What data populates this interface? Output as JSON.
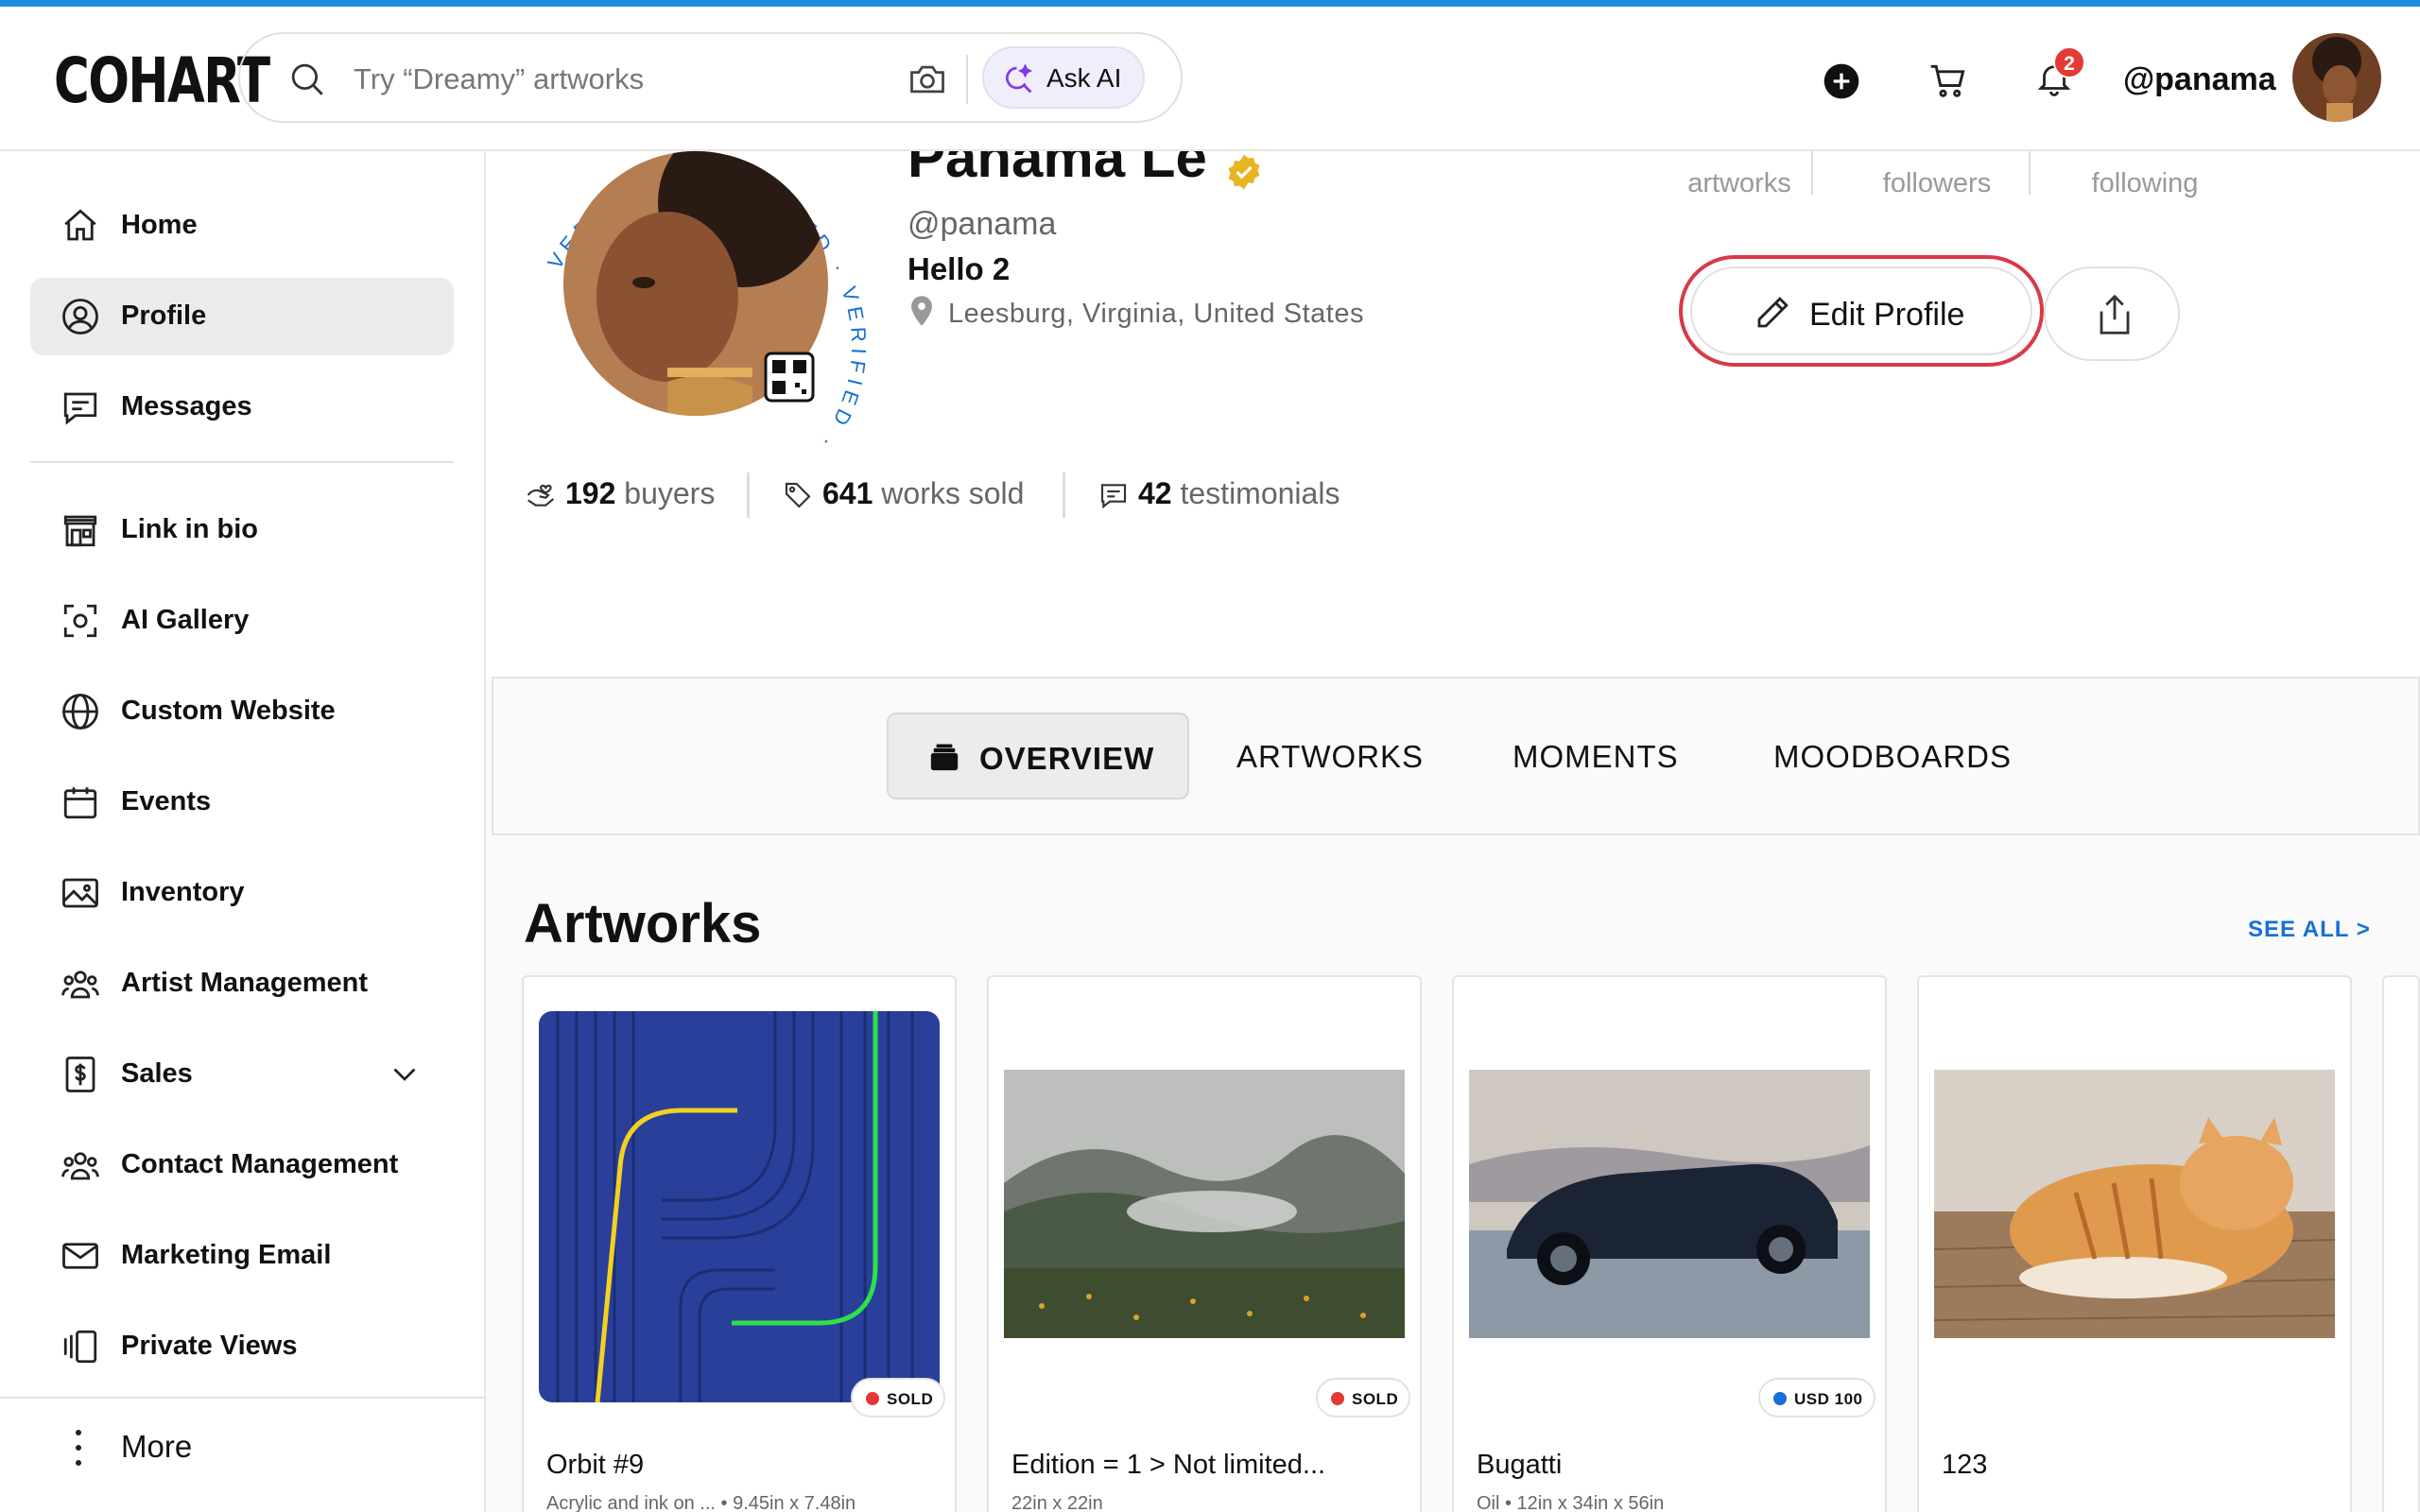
{
  "header": {
    "logo": "COHART",
    "search_placeholder": "Try “Dreamy” artworks",
    "ask_ai_label": "Ask AI",
    "notification_count": "2",
    "username": "@panama"
  },
  "sidebar": {
    "items": [
      {
        "label": "Home",
        "icon": "home-icon"
      },
      {
        "label": "Profile",
        "icon": "user-circle-icon",
        "active": true
      },
      {
        "label": "Messages",
        "icon": "message-icon"
      },
      {
        "label": "Link in bio",
        "icon": "storefront-icon"
      },
      {
        "label": "AI Gallery",
        "icon": "scan-face-icon"
      },
      {
        "label": "Custom Website",
        "icon": "globe-icon"
      },
      {
        "label": "Events",
        "icon": "calendar-icon"
      },
      {
        "label": "Inventory",
        "icon": "image-icon"
      },
      {
        "label": "Artist Management",
        "icon": "users-icon"
      },
      {
        "label": "Sales",
        "icon": "dollar-file-icon"
      },
      {
        "label": "Contact Management",
        "icon": "users-icon"
      },
      {
        "label": "Marketing Email",
        "icon": "mail-icon"
      },
      {
        "label": "Private Views",
        "icon": "private-views-icon"
      }
    ],
    "more_label": "More"
  },
  "profile": {
    "name": "Panama Le",
    "handle": "@panama",
    "bio": "Hello 2",
    "location": "Leesburg, Virginia, United States",
    "ring_text": "VERIFIED · VERIFIED · VERIFIED ·",
    "stats": [
      {
        "label": "artworks"
      },
      {
        "label": "followers"
      },
      {
        "label": "following"
      }
    ],
    "edit_label": "Edit Profile",
    "metrics": [
      {
        "value": "192",
        "label": "buyers"
      },
      {
        "value": "641",
        "label": "works sold"
      },
      {
        "value": "42",
        "label": "testimonials"
      }
    ]
  },
  "tabs": [
    {
      "label": "OVERVIEW",
      "active": true
    },
    {
      "label": "ARTWORKS"
    },
    {
      "label": "MOMENTS"
    },
    {
      "label": "MOODBOARDS"
    }
  ],
  "artworks": {
    "title": "Artworks",
    "see_all": "SEE ALL >",
    "items": [
      {
        "title": "Orbit #9",
        "meta": "Acrylic and ink on ...  •  9.45in x 7.48in",
        "badge": "SOLD",
        "badge_color": "#e53935"
      },
      {
        "title": "Edition = 1 > Not limited...",
        "meta": "22in x 22in",
        "badge": "SOLD",
        "badge_color": "#e53935"
      },
      {
        "title": "Bugatti",
        "meta": "Oil  •  12in x 34in x 56in",
        "badge": "USD 100",
        "badge_color": "#1670d6"
      },
      {
        "title": "123",
        "meta": "",
        "badge": "",
        "badge_color": ""
      }
    ]
  },
  "colors": {
    "accent": "#1670d6",
    "highlight_ring": "#d93a44",
    "verified": "#e8b420"
  }
}
